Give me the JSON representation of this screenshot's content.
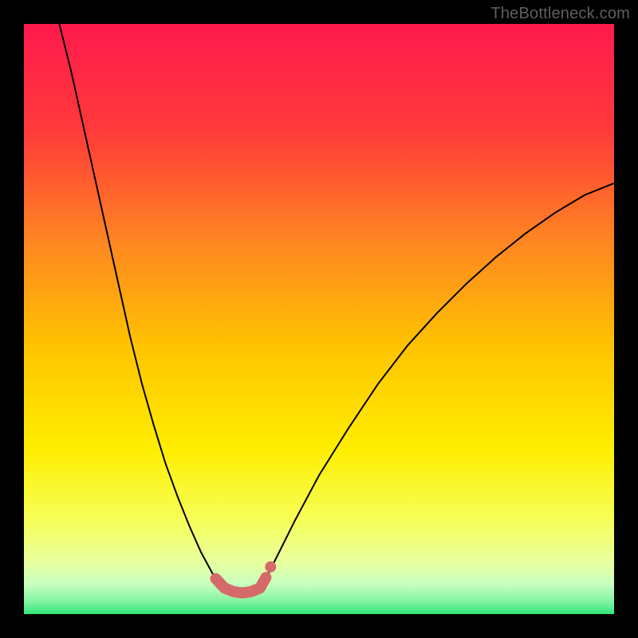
{
  "watermark": "TheBottleneck.com",
  "chart_data": {
    "type": "line",
    "title": "",
    "xlabel": "",
    "ylabel": "",
    "xlim": [
      0,
      1
    ],
    "ylim": [
      0,
      1
    ],
    "grid": false,
    "legend": false,
    "background_gradient": {
      "top": "#ff1a4e",
      "mid_upper": "#ff7a2a",
      "mid": "#ffd400",
      "mid_lower": "#f7ff33",
      "near_bottom": "#d8ffb0",
      "bottom": "#2fe67a"
    },
    "series": [
      {
        "name": "bottleneck-curve-left",
        "stroke": "#000000",
        "stroke_width": 2,
        "x": [
          0.06,
          0.08,
          0.1,
          0.12,
          0.14,
          0.16,
          0.18,
          0.2,
          0.22,
          0.24,
          0.26,
          0.28,
          0.3,
          0.32,
          0.33,
          0.34,
          0.345,
          0.35
        ],
        "y": [
          1.0,
          0.92,
          0.83,
          0.74,
          0.65,
          0.56,
          0.47,
          0.39,
          0.32,
          0.255,
          0.2,
          0.15,
          0.105,
          0.068,
          0.055,
          0.045,
          0.042,
          0.04
        ]
      },
      {
        "name": "bottleneck-curve-right",
        "stroke": "#000000",
        "stroke_width": 2,
        "x": [
          0.4,
          0.41,
          0.43,
          0.46,
          0.5,
          0.55,
          0.6,
          0.65,
          0.7,
          0.75,
          0.8,
          0.85,
          0.9,
          0.95,
          1.0
        ],
        "y": [
          0.04,
          0.06,
          0.1,
          0.16,
          0.235,
          0.315,
          0.39,
          0.455,
          0.51,
          0.56,
          0.605,
          0.645,
          0.68,
          0.71,
          0.73
        ]
      },
      {
        "name": "valley-highlight",
        "stroke": "#d66a6a",
        "stroke_width": 12,
        "x": [
          0.325,
          0.34,
          0.355,
          0.37,
          0.385,
          0.4,
          0.41
        ],
        "y": [
          0.06,
          0.044,
          0.038,
          0.036,
          0.038,
          0.044,
          0.062
        ]
      },
      {
        "name": "valley-end-dot",
        "type": "scatter",
        "fill": "#d66a6a",
        "x": [
          0.418
        ],
        "y": [
          0.08
        ]
      }
    ]
  }
}
